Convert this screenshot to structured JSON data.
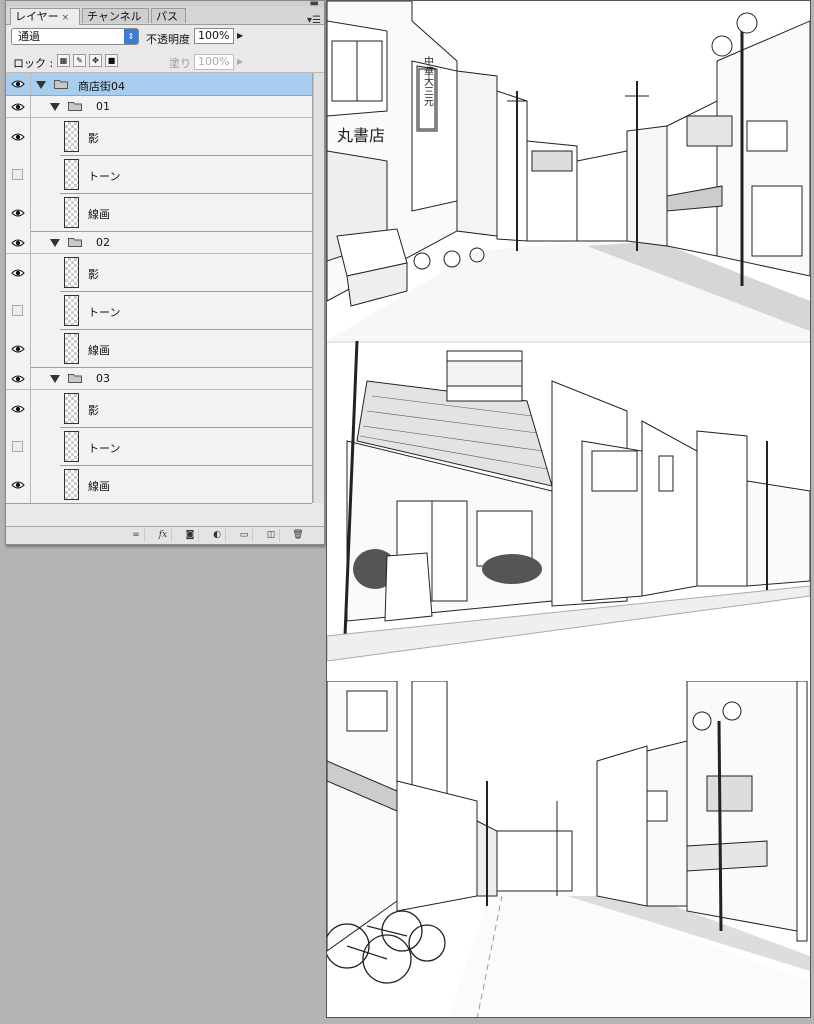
{
  "tabs": [
    {
      "label": "レイヤー",
      "close": "×"
    },
    {
      "label": "チャンネル"
    },
    {
      "label": "パス"
    }
  ],
  "blend_mode": "通過",
  "opacity_label": "不透明度 :",
  "opacity_value": "100%",
  "lock_label": "ロック :",
  "fill_label": "塗り :",
  "fill_value": "100%",
  "layers": [
    {
      "name": "商店街04",
      "type": "group",
      "visible": true,
      "selected": true
    },
    {
      "name": "01",
      "type": "group",
      "visible": true
    },
    {
      "name": "影",
      "type": "layer",
      "visible": true
    },
    {
      "name": "トーン",
      "type": "layer",
      "visible": false
    },
    {
      "name": "線画",
      "type": "layer",
      "visible": true
    },
    {
      "name": "02",
      "type": "group",
      "visible": true
    },
    {
      "name": "影",
      "type": "layer",
      "visible": true
    },
    {
      "name": "トーン",
      "type": "layer",
      "visible": false
    },
    {
      "name": "線画",
      "type": "layer",
      "visible": true
    },
    {
      "name": "03",
      "type": "group",
      "visible": true
    },
    {
      "name": "影",
      "type": "layer",
      "visible": true
    },
    {
      "name": "トーン",
      "type": "layer",
      "visible": false
    },
    {
      "name": "線画",
      "type": "layer",
      "visible": true
    }
  ],
  "bottom_icons": [
    "link-icon",
    "fx-icon",
    "mask-icon",
    "adjustment-icon",
    "new-group-icon",
    "new-layer-icon",
    "trash-icon"
  ],
  "bottom_labels": {
    "fx": "fx"
  },
  "canvas_sign_1": "中華大三元",
  "canvas_sign_2": "丸書店"
}
